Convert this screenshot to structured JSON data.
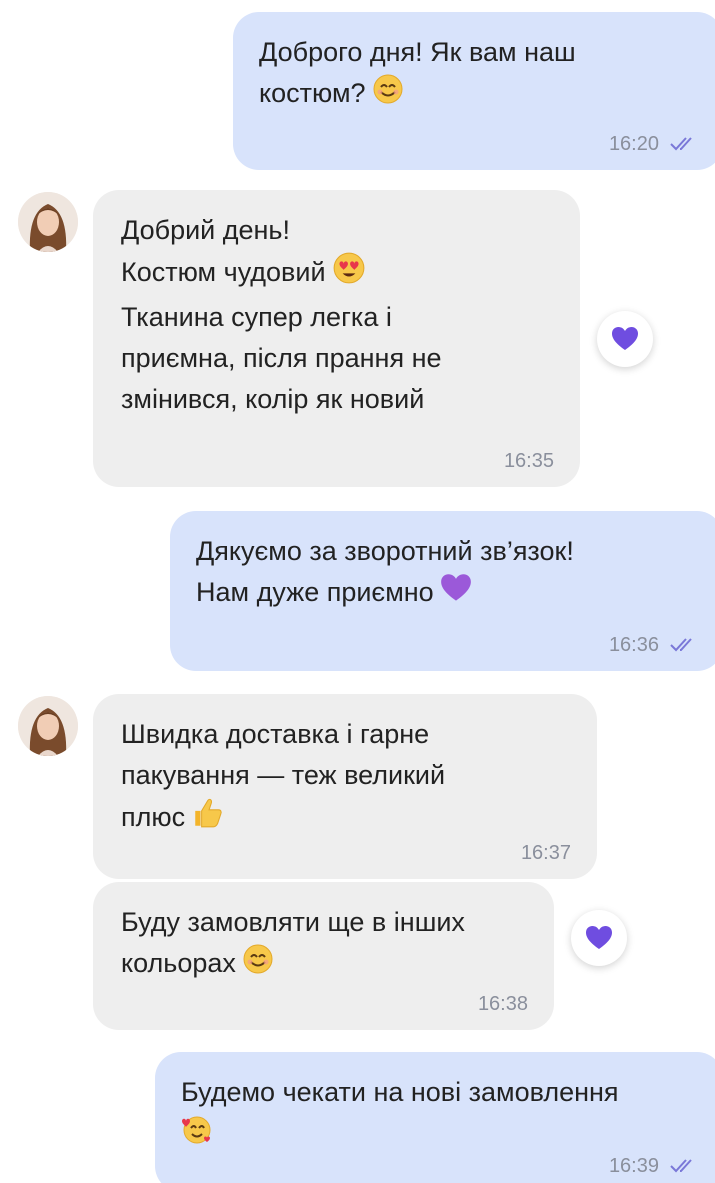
{
  "colors": {
    "outgoing_bubble": "#d8e3fb",
    "incoming_bubble": "#eeeeee",
    "read_ticks": "#7a78d8",
    "reaction_heart": "#6f4de0"
  },
  "messages": [
    {
      "direction": "outgoing",
      "lines": [
        "Доброго дня! Як вам наш",
        "костюм?"
      ],
      "emoji": "smiling-face-icon",
      "time": "16:20",
      "status": "read"
    },
    {
      "direction": "incoming",
      "lines": [
        "Добрий день!",
        "Костюм чудовий",
        "Тканина супер легка і",
        "приємна, після прання не",
        "змінився, колір як новий"
      ],
      "emoji": "heart-eyes-face-icon",
      "time": "16:35",
      "reaction": "purple-heart-icon"
    },
    {
      "direction": "outgoing",
      "lines": [
        "Дякуємо за зворотний зв’язок!",
        "Нам дуже приємно"
      ],
      "emoji": "purple-heart-icon",
      "time": "16:36",
      "status": "read"
    },
    {
      "direction": "incoming",
      "lines": [
        "Швидка доставка і гарне",
        "пакування — теж великий",
        "плюс"
      ],
      "emoji": "thumbs-up-icon",
      "time": "16:37"
    },
    {
      "direction": "incoming",
      "lines": [
        "Буду замовляти ще в інших",
        "кольорах"
      ],
      "emoji": "smiling-face-icon",
      "time": "16:38",
      "reaction": "purple-heart-icon"
    },
    {
      "direction": "outgoing",
      "lines": [
        "Будемо чекати на нові замовлення"
      ],
      "emoji": "smiling-face-with-hearts-icon",
      "time": "16:39",
      "status": "read"
    }
  ]
}
